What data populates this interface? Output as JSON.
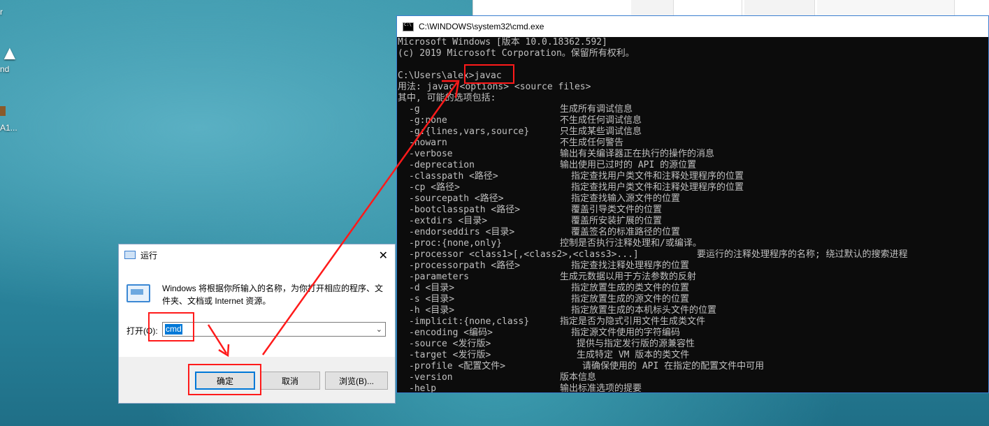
{
  "desktop": {
    "icon_labels": [
      "r",
      "nd",
      "A1..."
    ]
  },
  "cmd": {
    "title": "C:\\WINDOWS\\system32\\cmd.exe",
    "header_lines": [
      "Microsoft Windows [版本 10.0.18362.592]",
      "(c) 2019 Microsoft Corporation。保留所有权利。",
      "",
      "C:\\Users\\alex>javac",
      "用法: javac <options> <source files>",
      "其中, 可能的选项包括:"
    ],
    "options": [
      {
        "opt": "-g",
        "desc": "生成所有调试信息"
      },
      {
        "opt": "-g:none",
        "desc": "不生成任何调试信息"
      },
      {
        "opt": "-g:{lines,vars,source}",
        "desc": "只生成某些调试信息"
      },
      {
        "opt": "-nowarn",
        "desc": "不生成任何警告"
      },
      {
        "opt": "-verbose",
        "desc": "输出有关编译器正在执行的操作的消息"
      },
      {
        "opt": "-deprecation",
        "desc": "输出使用已过时的 API 的源位置"
      },
      {
        "opt": "-classpath <路径>",
        "desc": "指定查找用户类文件和注释处理程序的位置"
      },
      {
        "opt": "-cp <路径>",
        "desc": "指定查找用户类文件和注释处理程序的位置"
      },
      {
        "opt": "-sourcepath <路径>",
        "desc": "指定查找输入源文件的位置"
      },
      {
        "opt": "-bootclasspath <路径>",
        "desc": "覆盖引导类文件的位置"
      },
      {
        "opt": "-extdirs <目录>",
        "desc": "覆盖所安装扩展的位置"
      },
      {
        "opt": "-endorseddirs <目录>",
        "desc": "覆盖签名的标准路径的位置"
      },
      {
        "opt": "-proc:{none,only}",
        "desc": "控制是否执行注释处理和/或编译。"
      },
      {
        "opt": "-processor <class1>[,<class2>,<class3>...]",
        "desc": "要运行的注释处理程序的名称; 绕过默认的搜索进程"
      },
      {
        "opt": "-processorpath <路径>",
        "desc": "指定查找注释处理程序的位置"
      },
      {
        "opt": "-parameters",
        "desc": "生成元数据以用于方法参数的反射"
      },
      {
        "opt": "-d <目录>",
        "desc": "指定放置生成的类文件的位置"
      },
      {
        "opt": "-s <目录>",
        "desc": "指定放置生成的源文件的位置"
      },
      {
        "opt": "-h <目录>",
        "desc": "指定放置生成的本机标头文件的位置"
      },
      {
        "opt": "-implicit:{none,class}",
        "desc": "指定是否为隐式引用文件生成类文件"
      },
      {
        "opt": "-encoding <编码>",
        "desc": "指定源文件使用的字符编码"
      },
      {
        "opt": "-source <发行版>",
        "desc": "提供与指定发行版的源兼容性"
      },
      {
        "opt": "-target <发行版>",
        "desc": "生成特定 VM 版本的类文件"
      },
      {
        "opt": "-profile <配置文件>",
        "desc": "请确保使用的 API 在指定的配置文件中可用"
      },
      {
        "opt": "-version",
        "desc": "版本信息"
      },
      {
        "opt": "-help",
        "desc": "输出标准选项的提要"
      }
    ]
  },
  "run_dialog": {
    "title": "运行",
    "close_glyph": "✕",
    "description": "Windows 将根据你所输入的名称，为你打开相应的程序、文件夹、文档或 Internet 资源。",
    "open_label": "打开(O):",
    "input_value": "cmd",
    "ok_label": "确定",
    "cancel_label": "取消",
    "browse_label": "浏览(B)..."
  },
  "annotation_color": "#ff1a1a"
}
